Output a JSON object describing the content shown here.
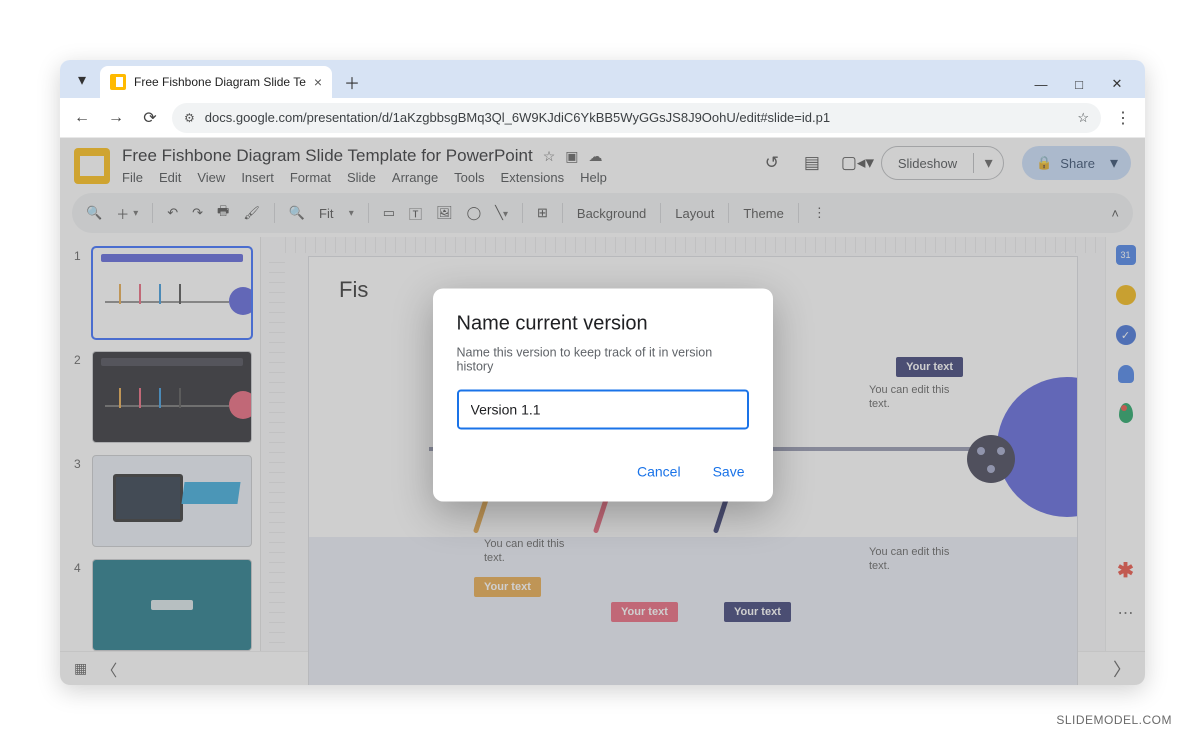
{
  "browser": {
    "tab_title": "Free Fishbone Diagram Slide Te",
    "url": "docs.google.com/presentation/d/1aKzgbbsgBMq3Ql_6W9KJdiC6YkBB5WyGGsJS8J9OohU/edit#slide=id.p1"
  },
  "doc": {
    "title": "Free Fishbone Diagram Slide Template for PowerPoint",
    "menus": [
      "File",
      "Edit",
      "View",
      "Insert",
      "Format",
      "Slide",
      "Arrange",
      "Tools",
      "Extensions",
      "Help"
    ]
  },
  "header_buttons": {
    "slideshow": "Slideshow",
    "share": "Share"
  },
  "toolbar": {
    "zoom_label": "Fit",
    "background": "Background",
    "layout": "Layout",
    "theme": "Theme"
  },
  "thumbs": [
    "1",
    "2",
    "3",
    "4"
  ],
  "slide": {
    "title_partial": "Fis",
    "tag": "Your text",
    "hint": "You can edit this text."
  },
  "dialog": {
    "title": "Name current version",
    "subtitle": "Name this version to keep track of it in version history",
    "input_value": "Version 1.1",
    "cancel": "Cancel",
    "save": "Save"
  },
  "watermark": "SLIDEMODEL.COM"
}
